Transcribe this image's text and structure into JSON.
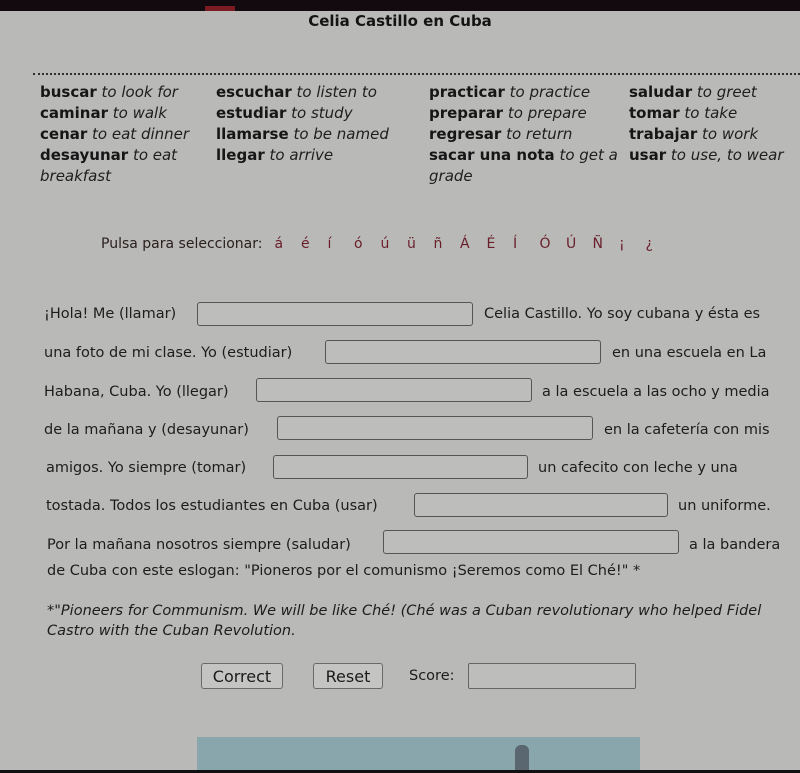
{
  "title": "Celia Castillo en Cuba",
  "vocab": {
    "col1": [
      {
        "word": "buscar",
        "meaning": "to look for"
      },
      {
        "word": "caminar",
        "meaning": "to walk"
      },
      {
        "word": "cenar",
        "meaning": "to eat dinner"
      },
      {
        "word": "desayunar",
        "meaning": "to eat breakfast"
      }
    ],
    "col2": [
      {
        "word": "escuchar",
        "meaning": "to listen to"
      },
      {
        "word": "estudiar",
        "meaning": "to study"
      },
      {
        "word": "llamarse",
        "meaning": "to be named"
      },
      {
        "word": "llegar",
        "meaning": "to arrive"
      }
    ],
    "col3": [
      {
        "word": "practicar",
        "meaning": "to practice"
      },
      {
        "word": "preparar",
        "meaning": "to prepare"
      },
      {
        "word": "regresar",
        "meaning": "to return"
      },
      {
        "word": "sacar una nota",
        "meaning": "to get a grade"
      }
    ],
    "col4": [
      {
        "word": "saludar",
        "meaning": "to greet"
      },
      {
        "word": "tomar",
        "meaning": "to take"
      },
      {
        "word": "trabajar",
        "meaning": "to work"
      },
      {
        "word": "usar",
        "meaning": "to use, to wear"
      }
    ]
  },
  "accents": {
    "label": "Pulsa para seleccionar:",
    "chars": [
      "á",
      "é",
      "í",
      "ó",
      "ú",
      "ü",
      "ñ",
      "Á",
      "É",
      "Í",
      "Ó",
      "Ú",
      "Ñ",
      "¡",
      "¿"
    ]
  },
  "passage": {
    "l1_pre": "¡Hola! Me (llamar)",
    "l1_post": "Celia Castillo. Yo soy cubana y ésta es",
    "l2_pre": "una foto de mi clase. Yo (estudiar)",
    "l2_post": "en una escuela en La",
    "l3_pre": "Habana, Cuba. Yo (llegar)",
    "l3_post": "a la escuela a las ocho y media",
    "l4_pre": "de la mañana y (desayunar)",
    "l4_post": "en la cafetería con mis",
    "l5_pre": "amigos. Yo siempre (tomar)",
    "l5_post": "un cafecito con leche y una",
    "l6_pre": "tostada. Todos los estudiantes en Cuba (usar)",
    "l6_post": "un uniforme.",
    "l7_pre": "Por la mañana nosotros siempre (saludar)",
    "l7_post": "a la bandera",
    "l8": "de Cuba con este eslogan: \"Pioneros  por el comunismo ¡Seremos como El Ché!\" *",
    "answers": [
      "",
      "",
      "",
      "",
      "",
      "",
      ""
    ]
  },
  "footnote": "*\"Pioneers for Communism. We will be like Ché! (Ché was a Cuban revolutionary who helped Fidel Castro with the Cuban Revolution.",
  "controls": {
    "correct_label": "Correct",
    "reset_label": "Reset",
    "score_label": "Score:",
    "score_value": ""
  }
}
